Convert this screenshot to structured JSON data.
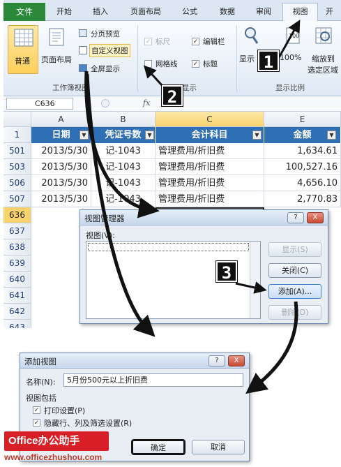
{
  "tabs": [
    "文件",
    "开始",
    "插入",
    "页面布局",
    "公式",
    "数据",
    "审阅",
    "视图",
    "开"
  ],
  "ribbon": {
    "workbook_views": {
      "normal": "普通",
      "page_layout": "页面布局",
      "page_break": "分页预览",
      "custom_views": "自定义视图",
      "full_screen": "全屏显示",
      "group": "工作簿视图"
    },
    "show": {
      "ruler": "标尺",
      "formula_bar": "编辑栏",
      "gridlines": "网格线",
      "headings": "标题",
      "group": "显示"
    },
    "zoom": {
      "zoom": "显示",
      "zoom100": "100%",
      "zoom_selection_1": "缩放到",
      "zoom_selection_2": "选定区域",
      "group": "显示比例"
    }
  },
  "formula_bar": {
    "name_box": "C636",
    "fx": "fx"
  },
  "columns": [
    "A",
    "B",
    "C",
    "E"
  ],
  "header_row": {
    "num": "1",
    "cells": [
      "日期",
      "凭证号数",
      "会计科目",
      "金额"
    ]
  },
  "rows": [
    {
      "num": "501",
      "date": "2013/5/30",
      "voucher": "记-1043",
      "account": "管理费用/折旧费",
      "amount": "1,634.61"
    },
    {
      "num": "503",
      "date": "2013/5/30",
      "voucher": "记-1043",
      "account": "管理费用/折旧费",
      "amount": "100,527.16"
    },
    {
      "num": "506",
      "date": "2013/5/30",
      "voucher": "记-1043",
      "account": "管理费用/折旧费",
      "amount": "4,656.10"
    },
    {
      "num": "507",
      "date": "2013/5/30",
      "voucher": "记-1043",
      "account": "管理费用/折旧费",
      "amount": "2,770.83"
    }
  ],
  "empty_rows": [
    "636",
    "637",
    "638",
    "639",
    "640",
    "641",
    "642",
    "643"
  ],
  "view_manager": {
    "title": "视图管理器",
    "help": "?",
    "close": "X",
    "list_label": "视图(V):",
    "show": "显示(S)",
    "close_btn": "关闭(C)",
    "add": "添加(A)...",
    "delete": "删除(D)"
  },
  "add_view": {
    "title": "添加视图",
    "help": "?",
    "close": "X",
    "name_label": "名称(N):",
    "name_value": "5月份500元以上折旧费",
    "include_label": "视图包括",
    "opt1": "打印设置(P)",
    "opt2": "隐藏行、列及筛选设置(R)",
    "ok": "确定",
    "cancel": "取消"
  },
  "callouts": [
    "1",
    "2",
    "3"
  ],
  "brand": {
    "logo": "Office办公助手",
    "site": "www.officezhushou.com"
  }
}
